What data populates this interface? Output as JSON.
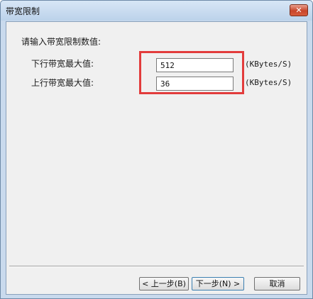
{
  "window": {
    "title": "带宽限制",
    "close_glyph": "✕"
  },
  "form": {
    "prompt": "请输入带宽限制数值:",
    "download": {
      "label": "下行带宽最大值:",
      "value": "512",
      "unit": "(KBytes/S)"
    },
    "upload": {
      "label": "上行带宽最大值:",
      "value": "36",
      "unit": "(KBytes/S)"
    }
  },
  "buttons": {
    "prev": "< 上一步(B)",
    "next": "下一步(N) >",
    "cancel": "取消"
  },
  "colors": {
    "highlight": "#e23c3c",
    "client_bg": "#f0f0f0",
    "frame": "#c9daed"
  }
}
